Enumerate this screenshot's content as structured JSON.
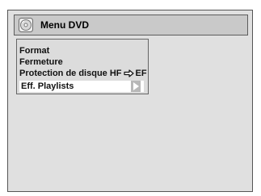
{
  "header": {
    "title": "Menu DVD",
    "icon": "disc-icon"
  },
  "menu": {
    "items": [
      {
        "label": "Format"
      },
      {
        "label": "Fermeture"
      },
      {
        "label": "Protection de disque HF",
        "arrow": "right-arrow-icon",
        "value": "EF"
      },
      {
        "label": "Eff. Playlists",
        "selected": true,
        "submenu_icon": "play-triangle-icon"
      }
    ]
  },
  "colors": {
    "screen_bg": "#e0e0e0",
    "title_bar_bg": "#c9c9c9",
    "selected_bg": "#ffffff"
  }
}
